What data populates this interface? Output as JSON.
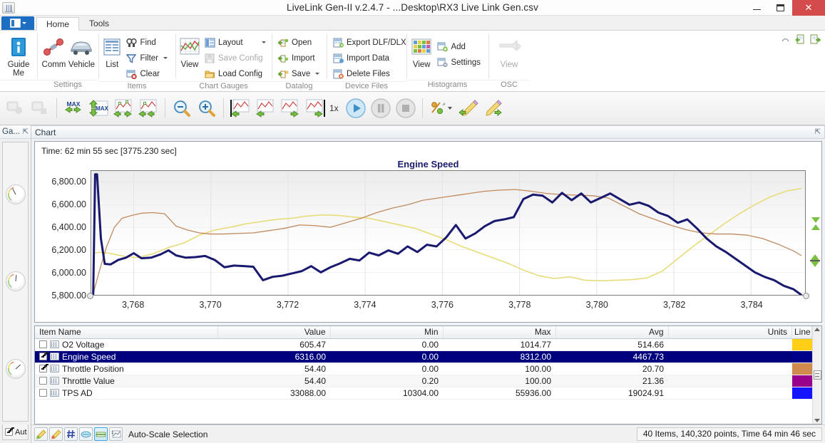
{
  "window": {
    "title": "LiveLink Gen-II  v.2.4.7 - ...Desktop\\RX3 Live Link Gen.csv",
    "app_icon": "app-grid-icon",
    "minimize": "–",
    "maximize": "❐",
    "close": "✕"
  },
  "ribbon": {
    "app_button": "file-menu-button",
    "tabs": [
      {
        "label": "Home",
        "active": true
      },
      {
        "label": "Tools",
        "active": false
      }
    ],
    "right_icons": [
      "help-icon",
      "import-icon",
      "export-icon"
    ],
    "groups": [
      {
        "label": "",
        "big": [
          {
            "label": "Guide\nMe",
            "icon": "guide-me-icon"
          }
        ],
        "small": []
      },
      {
        "label": "Settings",
        "big": [
          {
            "label": "Comm",
            "icon": "comm-icon"
          },
          {
            "label": "Vehicle",
            "icon": "vehicle-icon"
          }
        ],
        "small": []
      },
      {
        "label": "Items",
        "big": [
          {
            "label": "List",
            "icon": "list-icon"
          }
        ],
        "small": [
          {
            "label": "Find",
            "icon": "find-icon",
            "disabled": false,
            "caret": false
          },
          {
            "label": "Filter",
            "icon": "filter-icon",
            "disabled": false,
            "caret": true
          },
          {
            "label": "Clear",
            "icon": "clear-icon",
            "disabled": false,
            "caret": false
          }
        ]
      },
      {
        "label": "Chart  Gauges",
        "big": [
          {
            "label": "View",
            "icon": "chart-view-icon"
          }
        ],
        "small": [
          {
            "label": "Layout",
            "icon": "layout-icon",
            "disabled": false,
            "caret": true
          },
          {
            "label": "Save Config",
            "icon": "save-config-icon",
            "disabled": true,
            "caret": false
          },
          {
            "label": "Load Config",
            "icon": "load-config-icon",
            "disabled": false,
            "caret": false
          }
        ]
      },
      {
        "label": "Datalog",
        "big": [],
        "small": [
          {
            "label": "Open",
            "icon": "open-icon",
            "disabled": false,
            "caret": false
          },
          {
            "label": "Import",
            "icon": "import-icon",
            "disabled": false,
            "caret": false
          },
          {
            "label": "Save",
            "icon": "save-icon",
            "disabled": false,
            "caret": true
          }
        ]
      },
      {
        "label": "Device Files",
        "big": [],
        "small": [
          {
            "label": "Export DLF/DLX",
            "icon": "export-dlf-icon",
            "disabled": false,
            "caret": false
          },
          {
            "label": "Import Data",
            "icon": "import-data-icon",
            "disabled": false,
            "caret": false
          },
          {
            "label": "Delete Files",
            "icon": "delete-files-icon",
            "disabled": false,
            "caret": false
          }
        ]
      },
      {
        "label": "Histograms",
        "big": [
          {
            "label": "View",
            "icon": "histogram-view-icon"
          }
        ],
        "small": [
          {
            "label": "Add",
            "icon": "add-icon",
            "disabled": false,
            "caret": false
          },
          {
            "label": "Settings",
            "icon": "settings-icon",
            "disabled": false,
            "caret": false
          }
        ]
      },
      {
        "label": "OSC",
        "big": [
          {
            "label": "View",
            "icon": "osc-view-icon",
            "disabled": true
          }
        ],
        "small": []
      }
    ]
  },
  "toolbar": {
    "speed_label": "1x",
    "buttons": [
      "gauge-snapshot-icon",
      "gauge-record-icon",
      "max-left-right-icon",
      "max-updown-icon",
      "chart-pan-icon",
      "chart-pan-both-icon",
      "zoom-out-icon",
      "zoom-in-icon",
      "marker-left-icon",
      "chart-left-icon",
      "chart-right-icon",
      "marker-right-icon",
      "play-icon",
      "pause-icon",
      "stop-icon",
      "percent-icon",
      "pencil-left-icon",
      "pencil-right-icon"
    ]
  },
  "gauges_panel": {
    "title": "Ga...",
    "pin": "⇱",
    "auto_label": "Aut",
    "auto_checked": true,
    "gauges": [
      "gauge-1",
      "gauge-2",
      "gauge-3"
    ]
  },
  "dock": {
    "title": "Chart",
    "pin": "⇱"
  },
  "chart_data": {
    "type": "line",
    "title": "Engine Speed",
    "time_label": "Time: 62 min 55 sec [3775.230 sec]",
    "xlabel": "",
    "ylabel": "",
    "grid": true,
    "legend": "none",
    "ylim": [
      5800,
      6900
    ],
    "xlim": [
      3766.9,
      3785.4
    ],
    "yticks": [
      "6,800.00",
      "6,600.00",
      "6,400.00",
      "6,200.00",
      "6,000.00",
      "5,800.00"
    ],
    "ytick_values": [
      6800,
      6600,
      6400,
      6200,
      6000,
      5800
    ],
    "xticks": [
      "3,768",
      "3,770",
      "3,772",
      "3,774",
      "3,776",
      "3,778",
      "3,780",
      "3,782",
      "3,784"
    ],
    "xtick_values": [
      3768,
      3770,
      3772,
      3774,
      3776,
      3778,
      3780,
      3782,
      3784
    ],
    "series": [
      {
        "name": "Engine Speed",
        "color": "#191970",
        "width": 3,
        "x": [
          3766.95,
          3767.0,
          3767.05,
          3767.15,
          3767.25,
          3767.4,
          3767.6,
          3767.8,
          3768.0,
          3768.2,
          3768.45,
          3768.7,
          3768.9,
          3769.1,
          3769.35,
          3769.6,
          3769.85,
          3770.1,
          3770.35,
          3770.6,
          3770.85,
          3771.1,
          3771.35,
          3771.6,
          3771.85,
          3772.1,
          3772.35,
          3772.6,
          3772.85,
          3773.1,
          3773.35,
          3773.6,
          3773.85,
          3774.1,
          3774.35,
          3774.6,
          3774.85,
          3775.1,
          3775.35,
          3775.6,
          3775.85,
          3776.1,
          3776.35,
          3776.6,
          3776.85,
          3777.1,
          3777.35,
          3777.6,
          3777.85,
          3778.1,
          3778.35,
          3778.6,
          3778.85,
          3779.1,
          3779.35,
          3779.6,
          3779.85,
          3780.1,
          3780.35,
          3780.6,
          3780.85,
          3781.1,
          3781.35,
          3781.6,
          3781.85,
          3782.1,
          3782.35,
          3782.6,
          3782.85,
          3783.1,
          3783.35,
          3783.6,
          3783.85,
          3784.1,
          3784.35,
          3784.6,
          3784.85,
          3785.1,
          3785.3
        ],
        "y": [
          5800,
          6870,
          6870,
          6300,
          6075,
          6070,
          6110,
          6130,
          6170,
          6125,
          6130,
          6160,
          6195,
          6150,
          6130,
          6135,
          6145,
          6110,
          6045,
          6060,
          6055,
          6050,
          5930,
          5960,
          5970,
          5990,
          6010,
          6055,
          6000,
          6045,
          6080,
          6120,
          6105,
          6175,
          6150,
          6195,
          6165,
          6230,
          6180,
          6245,
          6230,
          6310,
          6420,
          6300,
          6345,
          6410,
          6455,
          6470,
          6490,
          6650,
          6690,
          6680,
          6620,
          6705,
          6640,
          6700,
          6620,
          6660,
          6700,
          6650,
          6600,
          6620,
          6590,
          6530,
          6500,
          6440,
          6470,
          6390,
          6300,
          6230,
          6180,
          6120,
          6060,
          6000,
          5960,
          5930,
          5880,
          5850,
          5800
        ]
      },
      {
        "name": "Throttle Position",
        "color": "#c08a5e",
        "width": 1.3,
        "x": [
          3766.95,
          3767.1,
          3767.3,
          3767.5,
          3767.7,
          3767.95,
          3768.2,
          3768.5,
          3768.8,
          3769.1,
          3769.4,
          3769.7,
          3770.0,
          3770.3,
          3770.7,
          3771.1,
          3771.5,
          3771.9,
          3772.3,
          3772.7,
          3773.1,
          3773.5,
          3773.9,
          3774.3,
          3774.7,
          3775.1,
          3775.5,
          3775.9,
          3776.3,
          3776.7,
          3777.1,
          3777.5,
          3777.9,
          3778.3,
          3778.7,
          3779.1,
          3779.5,
          3779.9,
          3780.3,
          3780.7,
          3781.1,
          3781.5,
          3781.9,
          3782.3,
          3782.7,
          3783.1,
          3783.5,
          3783.9,
          3784.3,
          3784.7,
          3785.1,
          3785.3
        ],
        "y": [
          5810,
          6000,
          6230,
          6400,
          6480,
          6505,
          6525,
          6530,
          6520,
          6410,
          6375,
          6350,
          6340,
          6340,
          6345,
          6350,
          6370,
          6390,
          6420,
          6415,
          6400,
          6440,
          6480,
          6530,
          6570,
          6600,
          6640,
          6660,
          6680,
          6700,
          6720,
          6730,
          6735,
          6720,
          6700,
          6690,
          6685,
          6680,
          6660,
          6590,
          6520,
          6470,
          6420,
          6380,
          6350,
          6340,
          6340,
          6330,
          6300,
          6250,
          6190,
          6150
        ]
      },
      {
        "name": "O2 Voltage",
        "color": "#e8dc7a",
        "width": 1.6,
        "x": [
          3766.95,
          3767.2,
          3767.5,
          3767.8,
          3768.1,
          3768.5,
          3768.9,
          3769.3,
          3769.7,
          3770.1,
          3770.5,
          3770.9,
          3771.3,
          3771.7,
          3772.1,
          3772.5,
          3772.9,
          3773.3,
          3773.7,
          3774.1,
          3774.5,
          3774.9,
          3775.3,
          3775.7,
          3776.1,
          3776.5,
          3776.9,
          3777.3,
          3777.7,
          3778.1,
          3778.5,
          3778.9,
          3779.3,
          3779.7,
          3780.1,
          3780.5,
          3780.9,
          3781.3,
          3781.7,
          3782.1,
          3782.5,
          3782.9,
          3783.3,
          3783.7,
          3784.1,
          3784.5,
          3784.9,
          3785.3
        ],
        "y": [
          6170,
          6180,
          6160,
          6140,
          6130,
          6165,
          6220,
          6260,
          6330,
          6375,
          6400,
          6430,
          6450,
          6470,
          6480,
          6500,
          6510,
          6505,
          6490,
          6480,
          6450,
          6420,
          6390,
          6340,
          6290,
          6230,
          6180,
          6130,
          6080,
          6020,
          5970,
          5945,
          5960,
          5930,
          5925,
          5930,
          5935,
          5950,
          6010,
          6120,
          6230,
          6330,
          6430,
          6520,
          6600,
          6670,
          6720,
          6745
        ]
      }
    ]
  },
  "table": {
    "columns": [
      "Item Name",
      "Value",
      "Min",
      "Max",
      "Avg",
      "Units",
      "Line"
    ],
    "rows": [
      {
        "checked": false,
        "name": "O2 Voltage",
        "value": "605.47",
        "min": "0.00",
        "max": "1014.77",
        "avg": "514.66",
        "units": "",
        "color": "#FFCE17",
        "selected": false
      },
      {
        "checked": true,
        "name": "Engine Speed",
        "value": "6316.00",
        "min": "0.00",
        "max": "8312.00",
        "avg": "4467.73",
        "units": "",
        "color": "#00008B",
        "selected": true
      },
      {
        "checked": true,
        "name": "Throttle Position",
        "value": "54.40",
        "min": "0.00",
        "max": "100.00",
        "avg": "20.70",
        "units": "",
        "color": "#D08A4E",
        "selected": false
      },
      {
        "checked": false,
        "name": "Throttle Value",
        "value": "54.40",
        "min": "0.20",
        "max": "100.00",
        "avg": "21.36",
        "units": "",
        "color": "#99008C",
        "selected": false
      },
      {
        "checked": false,
        "name": "TPS AD",
        "value": "33088.00",
        "min": "10304.00",
        "max": "55936.00",
        "avg": "19024.91",
        "units": "",
        "color": "#1414FF",
        "selected": false
      }
    ]
  },
  "statusbar": {
    "buttons": [
      "pencil-green-icon",
      "pencil-red-icon",
      "hash-icon",
      "oval-icon",
      "scale-icon",
      "autoscale-icon"
    ],
    "mode_label": "Auto-Scale Selection",
    "info": "40 Items, 140,320 points, Time 64 min 46 sec"
  }
}
